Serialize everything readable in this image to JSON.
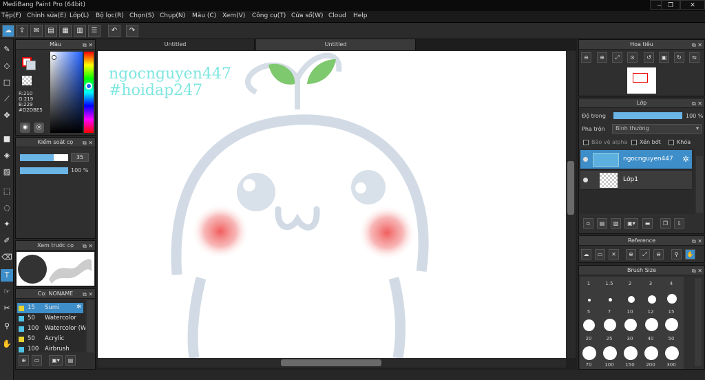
{
  "window": {
    "title": "MediBang Paint Pro (64bit)"
  },
  "menu": [
    "Tệp(F)",
    "Chỉnh sửa(E)",
    "Lớp(L)",
    "Bộ lọc(R)",
    "Chọn(S)",
    "Chụp(N)",
    "Màu (C)",
    "Xem(V)",
    "Công cụ(T)",
    "Cửa sổ(W)",
    "Cloud",
    "Help"
  ],
  "tabs": [
    "Untitled",
    "Untitled"
  ],
  "color_panel": {
    "title": "Màu",
    "r": "R:210",
    "g": "G:219",
    "b": "B:229",
    "hex": "#D2DBE5",
    "main_color": "#d2dbe5"
  },
  "brush_control": {
    "title": "Kiểm soát cọ",
    "size_value": "35",
    "opacity_value": "100 %",
    "size_fraction": 0.7,
    "opacity_fraction": 1.0
  },
  "brush_preview": {
    "title": "Xem trước cọ"
  },
  "brush_list": {
    "title": "Cọ: NONAME",
    "items": [
      {
        "size": "15",
        "name": "Sumi",
        "color": "#e8d230",
        "selected": true
      },
      {
        "size": "50",
        "name": "Watercolor",
        "color": "#4fc3e8"
      },
      {
        "size": "100",
        "name": "Watercolor (W",
        "color": "#4fc3e8"
      },
      {
        "size": "50",
        "name": "Acrylic",
        "color": "#e8d230"
      },
      {
        "size": "100",
        "name": "Airbrush",
        "color": "#4fc3e8"
      }
    ]
  },
  "canvas": {
    "text1": "ngocnguyen447",
    "text2": "#hoidap247",
    "text_color": "#7fe6e0"
  },
  "navigator": {
    "title": "Hoa tiêu"
  },
  "layers": {
    "title": "Lớp",
    "opacity_label": "Độ trong",
    "opacity_value": "100 %",
    "opacity_fraction": 1.0,
    "blend_label": "Pha trộn",
    "blend_value": "Bình thường",
    "protect_alpha": "Bảo vệ alpha",
    "clipping": "Xén bớt",
    "lock": "Khóa",
    "items": [
      {
        "name": "ngocnguyen447",
        "selected": true
      },
      {
        "name": "Lớp1",
        "selected": false
      }
    ]
  },
  "reference": {
    "title": "Reference"
  },
  "brush_size": {
    "title": "Brush Size",
    "sizes": [
      "1",
      "1.5",
      "2",
      "3",
      "4",
      "5",
      "7",
      "10",
      "12",
      "15",
      "20",
      "25",
      "30",
      "40",
      "50",
      "70",
      "100",
      "150",
      "200",
      "300"
    ]
  },
  "accent": "#3d8ec9"
}
